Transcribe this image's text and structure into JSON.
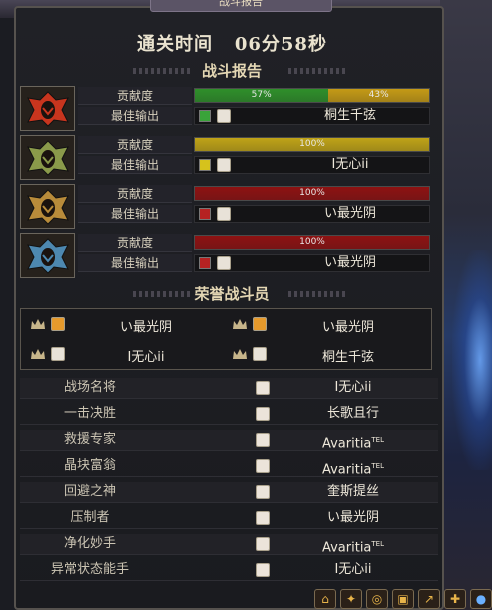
{
  "window": {
    "title": "战斗报告"
  },
  "header": {
    "time_label": "通关时间",
    "time_value": "06分58秒"
  },
  "battle_report": {
    "title": "战斗报告",
    "contrib_label": "贡献度",
    "best_label": "最佳输出",
    "rows": [
      {
        "icon": "red-spiked-mask-icon",
        "segments": [
          {
            "pct": 57,
            "label": "57%",
            "color": "#2f8f2a"
          },
          {
            "pct": 43,
            "label": "43%",
            "color": "#c49a16"
          }
        ],
        "best": {
          "job_color": "#3aa33a",
          "name": "桐生千弦"
        }
      },
      {
        "icon": "green-spiked-mask-icon",
        "segments": [
          {
            "pct": 100,
            "label": "100%",
            "color": "#bfa317"
          }
        ],
        "best": {
          "job_color": "#d6c21c",
          "name": "I无心ii"
        }
      },
      {
        "icon": "gold-spiked-mask-icon",
        "segments": [
          {
            "pct": 100,
            "label": "100%",
            "color": "#8e1212"
          }
        ],
        "best": {
          "job_color": "#b62222",
          "name": "い最光阴"
        }
      },
      {
        "icon": "blue-spiked-mask-icon",
        "segments": [
          {
            "pct": 100,
            "label": "100%",
            "color": "#8e1212"
          }
        ],
        "best": {
          "job_color": "#b62222",
          "name": "い最光阴"
        }
      }
    ]
  },
  "honor": {
    "title": "荣誉战斗员",
    "members": [
      {
        "name": "い最光阴",
        "avatar": "flame-hair-avatar"
      },
      {
        "name": "い最光阴",
        "avatar": "flame-hair-avatar"
      },
      {
        "name": "I无心ii",
        "avatar": "white-hair-avatar"
      },
      {
        "name": "桐生千弦",
        "avatar": "white-hair-avatar"
      }
    ]
  },
  "awards": [
    {
      "title": "战场名将",
      "name": "I无心ii",
      "tag": ""
    },
    {
      "title": "一击决胜",
      "name": "长歌且行",
      "tag": ""
    },
    {
      "title": "救援专家",
      "name": "Avaritia",
      "tag": "TEL"
    },
    {
      "title": "晶块富翁",
      "name": "Avaritia",
      "tag": "TEL"
    },
    {
      "title": "回避之神",
      "name": "奎斯提丝",
      "tag": ""
    },
    {
      "title": "压制者",
      "name": "い最光阴",
      "tag": ""
    },
    {
      "title": "净化妙手",
      "name": "Avaritia",
      "tag": "TEL"
    },
    {
      "title": "异常状态能手",
      "name": "I无心ii",
      "tag": ""
    }
  ],
  "colors": {
    "accent_gold": "#e4d7b4",
    "panel_border": "#56524e"
  }
}
